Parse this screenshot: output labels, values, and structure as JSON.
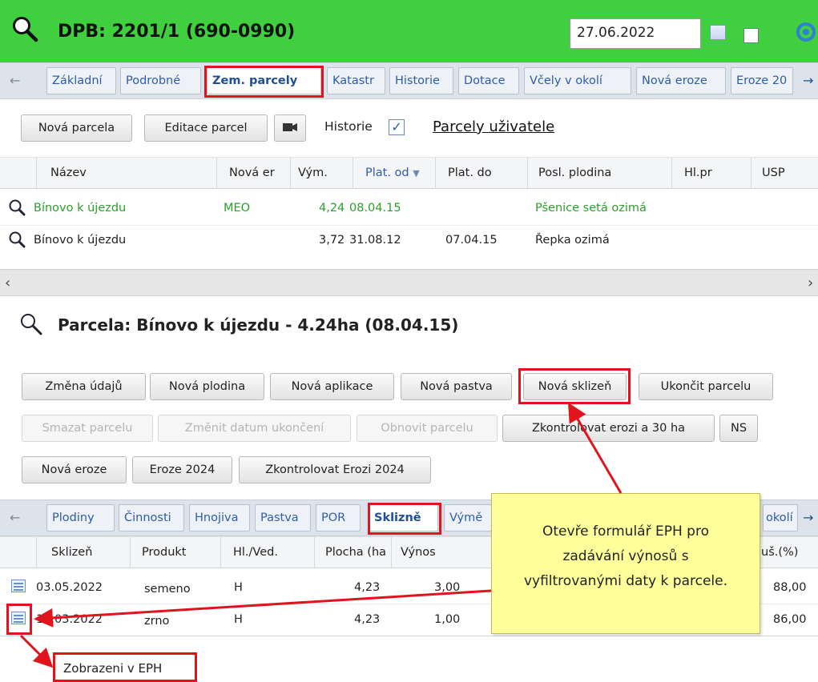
{
  "header": {
    "title": "DPB: 2201/1 (690-0990)",
    "date": "27.06.2022"
  },
  "main_tabs": [
    "Základní",
    "Podrobné",
    "Zem. parcely",
    "Katastr",
    "Historie",
    "Dotace",
    "Včely v okolí",
    "Nová eroze",
    "Eroze 20"
  ],
  "toolbar": {
    "new_parcel": "Nová parcela",
    "edit_parcels": "Editace parcel",
    "history_label": "Historie",
    "user_parcels_link": "Parcely uživatele"
  },
  "parcels_table": {
    "columns": [
      "Název",
      "Nová er",
      "Vým.",
      "Plat. od",
      "Plat. do",
      "Posl. plodina",
      "Hl.pr",
      "USP"
    ],
    "rows": [
      {
        "name": "Bínovo k újezdu",
        "new_er": "MEO",
        "area": "4,24",
        "from": "08.04.15",
        "to": "",
        "crop": "Pšenice setá ozimá"
      },
      {
        "name": "Bínovo k újezdu",
        "new_er": "",
        "area": "3,72",
        "from": "31.08.12",
        "to": "07.04.15",
        "crop": "Řepka ozimá"
      }
    ]
  },
  "parcel_detail": {
    "title": "Parcela: Bínovo k újezdu - 4.24ha (08.04.15)",
    "buttons_row1": [
      "Změna údajů",
      "Nová plodina",
      "Nová aplikace",
      "Nová pastva",
      "Nová sklizeň",
      "Ukončit parcelu"
    ],
    "buttons_row2": [
      "Smazat parcelu",
      "Změnit datum ukončení",
      "Obnovit parcelu",
      "Zkontrolovat erozi a 30 ha",
      "NS"
    ],
    "buttons_row3": [
      "Nová eroze",
      "Eroze 2024",
      "Zkontrolovat Erozi 2024"
    ]
  },
  "sub_tabs": [
    "Plodiny",
    "Činnosti",
    "Hnojiva",
    "Pastva",
    "POR",
    "Sklizně",
    "Výmě",
    "okolí"
  ],
  "harvest_table": {
    "columns": [
      "Sklizeň",
      "Produkt",
      "Hl./Ved.",
      "Plocha (ha",
      "Výnos",
      "uš.(%)"
    ],
    "rows": [
      {
        "date": "03.05.2022",
        "product": "semeno",
        "type": "H",
        "area": "4,23",
        "yield": "3,00",
        "pct": "88,00"
      },
      {
        "date": "10.03.2022",
        "product": "zrno",
        "type": "H",
        "area": "4,23",
        "yield": "1,00",
        "pct": "86,00"
      }
    ]
  },
  "tooltip": {
    "line1": "Otevře formulář EPH pro",
    "line2": "zadávání výnosů s",
    "line3": "vyfiltrovanými daty k parcele."
  },
  "callout_label": "Zobrazeni v EPH",
  "colors": {
    "header_bg": "#3fcf3f",
    "highlight_red": "#e0141c",
    "tooltip_bg": "#ffff9c",
    "link_blue": "#2d5da8",
    "green_text": "#2aa02a"
  }
}
